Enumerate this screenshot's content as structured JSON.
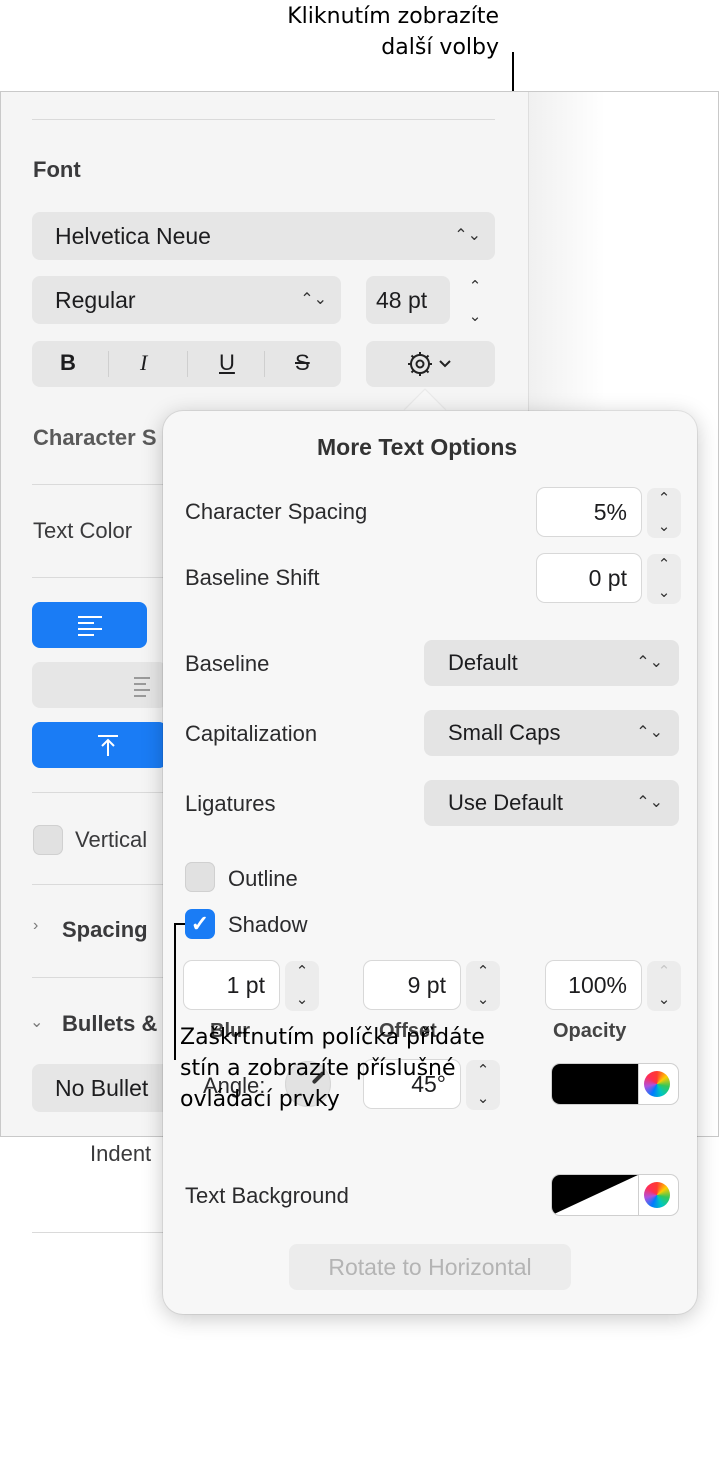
{
  "callouts": {
    "top_line1": "Kliknutím zobrazíte",
    "top_line2": "další volby",
    "bottom_line1": "Zaškrtnutím políčka přidáte",
    "bottom_line2": "stín a zobrazíte příslušné",
    "bottom_line3": "ovládací prvky"
  },
  "sidebar": {
    "font_header": "Font",
    "font_family": "Helvetica Neue",
    "font_style": "Regular",
    "font_size": "48 pt",
    "bold_label": "B",
    "italic_label": "I",
    "underline_label": "U",
    "strike_label": "S",
    "character_styles_label": "Character S",
    "text_color_label": "Text Color",
    "vertical_text_label": "Vertical",
    "spacing_label": "Spacing",
    "bullets_label": "Bullets &",
    "no_bullets_label": "No Bullet",
    "indent_label": "Indent"
  },
  "popover": {
    "title": "More Text Options",
    "character_spacing_label": "Character Spacing",
    "character_spacing_value": "5%",
    "baseline_shift_label": "Baseline Shift",
    "baseline_shift_value": "0 pt",
    "baseline_label": "Baseline",
    "baseline_value": "Default",
    "capitalization_label": "Capitalization",
    "capitalization_value": "Small Caps",
    "ligatures_label": "Ligatures",
    "ligatures_value": "Use Default",
    "outline_label": "Outline",
    "outline_checked": false,
    "shadow_label": "Shadow",
    "shadow_checked": true,
    "blur_value": "1 pt",
    "blur_label": "Blur",
    "offset_value": "9 pt",
    "offset_label": "Offset",
    "opacity_value": "100%",
    "opacity_label": "Opacity",
    "angle_label": "Angle:",
    "angle_value": "45°",
    "shadow_color": "#000000",
    "text_background_label": "Text Background",
    "rotate_button_label": "Rotate to Horizontal"
  },
  "colors": {
    "accent": "#1a7cf5",
    "sidebar_bg": "#f5f5f5",
    "popover_bg": "#f7f7f7"
  },
  "icons": {
    "gear_menu": "gear-chevron-icon",
    "align_left": "align-left-icon",
    "align_top": "align-top-icon",
    "indent": "indent-icon",
    "color_wheel": "color-wheel-icon"
  }
}
